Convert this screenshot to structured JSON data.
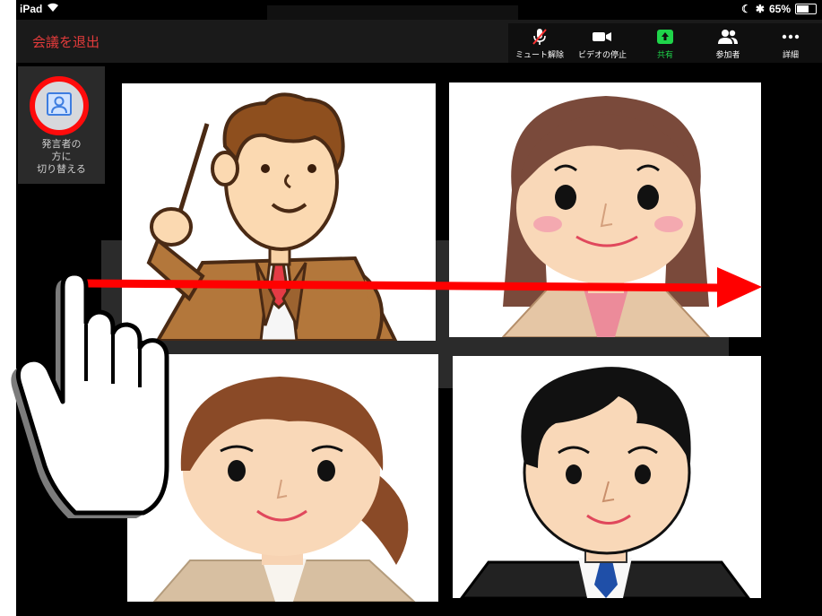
{
  "status_bar": {
    "device": "iPad",
    "battery": "65%",
    "battery_fraction": 0.65
  },
  "header": {
    "leave_label": "会議を退出"
  },
  "toolbar": {
    "items": [
      {
        "icon": "mic-muted-icon",
        "label": "ミュート解除"
      },
      {
        "icon": "video-camera-icon",
        "label": "ビデオの停止"
      },
      {
        "icon": "share-screen-icon",
        "label": "共有"
      },
      {
        "icon": "participants-icon",
        "label": "参加者"
      },
      {
        "icon": "more-icon",
        "label": "詳細"
      }
    ]
  },
  "view_switch": {
    "label_lines": [
      "発言者の",
      "方に",
      "切り替える"
    ]
  },
  "participants": [
    {
      "role": "presenter-man-with-pointer"
    },
    {
      "role": "woman-long-hair"
    },
    {
      "role": "woman-ponytail"
    },
    {
      "role": "man-suit"
    }
  ],
  "annotations": {
    "arrow_color": "#ff0000",
    "circle_color": "#ff0b0b",
    "gesture": "swipe-right"
  },
  "colors": {
    "leave_text": "#e23b3b",
    "share_green": "#1fd44a"
  }
}
